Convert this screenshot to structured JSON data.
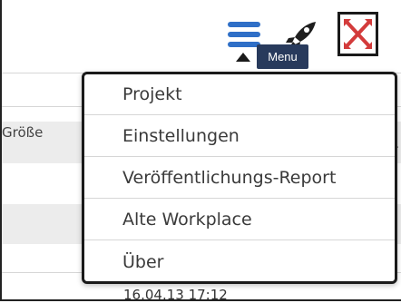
{
  "toolbar": {
    "menu_icon": "hamburger-icon",
    "rocket_icon": "rocket-icon",
    "close_icon": "x-icon",
    "accent_color": "#2f6fc7"
  },
  "tooltip": {
    "text": "Menu"
  },
  "table": {
    "column_header": "Größe",
    "row_date": "16.04.13 17:12"
  },
  "menu": {
    "items": [
      {
        "label": "Projekt"
      },
      {
        "label": "Einstellungen"
      },
      {
        "label": "Veröffentlichungs-Report"
      },
      {
        "label": "Alte Workplace"
      },
      {
        "label": "Über"
      }
    ]
  }
}
